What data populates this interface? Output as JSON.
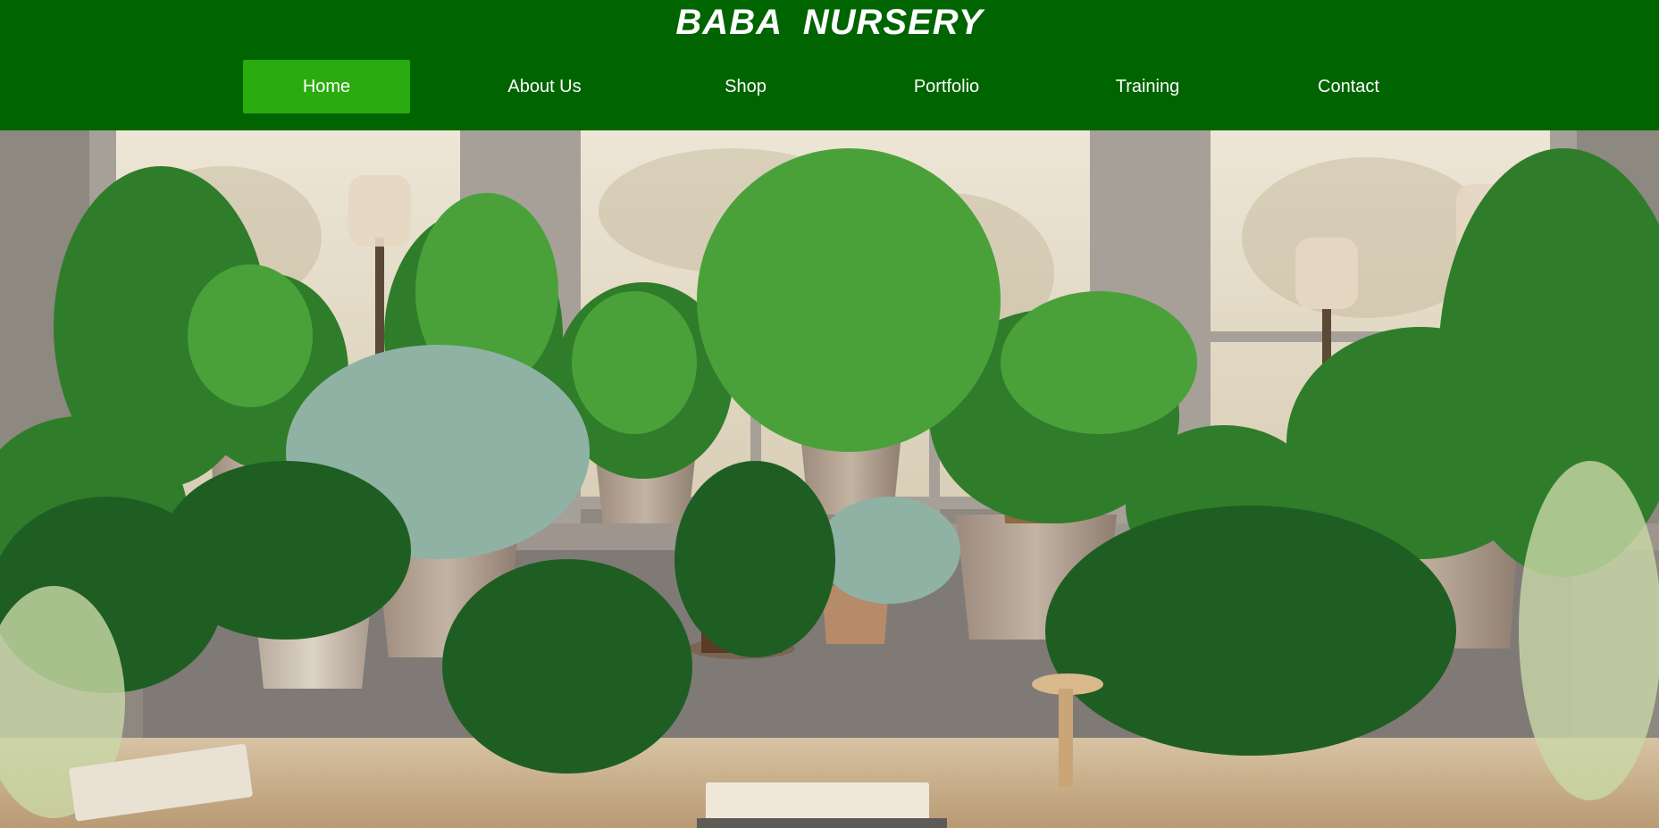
{
  "brand": {
    "title": "BABA  NURSERY"
  },
  "nav": {
    "items": [
      {
        "label": "Home",
        "active": true
      },
      {
        "label": "About Us",
        "active": false
      },
      {
        "label": "Shop",
        "active": false
      },
      {
        "label": "Portfolio",
        "active": false
      },
      {
        "label": "Training",
        "active": false
      },
      {
        "label": "Contact",
        "active": false
      }
    ]
  },
  "colors": {
    "header_bg": "#006400",
    "active_tab": "#2aab10",
    "text": "#ffffff"
  },
  "hero": {
    "image": "potted-houseplants-by-window-photo"
  }
}
